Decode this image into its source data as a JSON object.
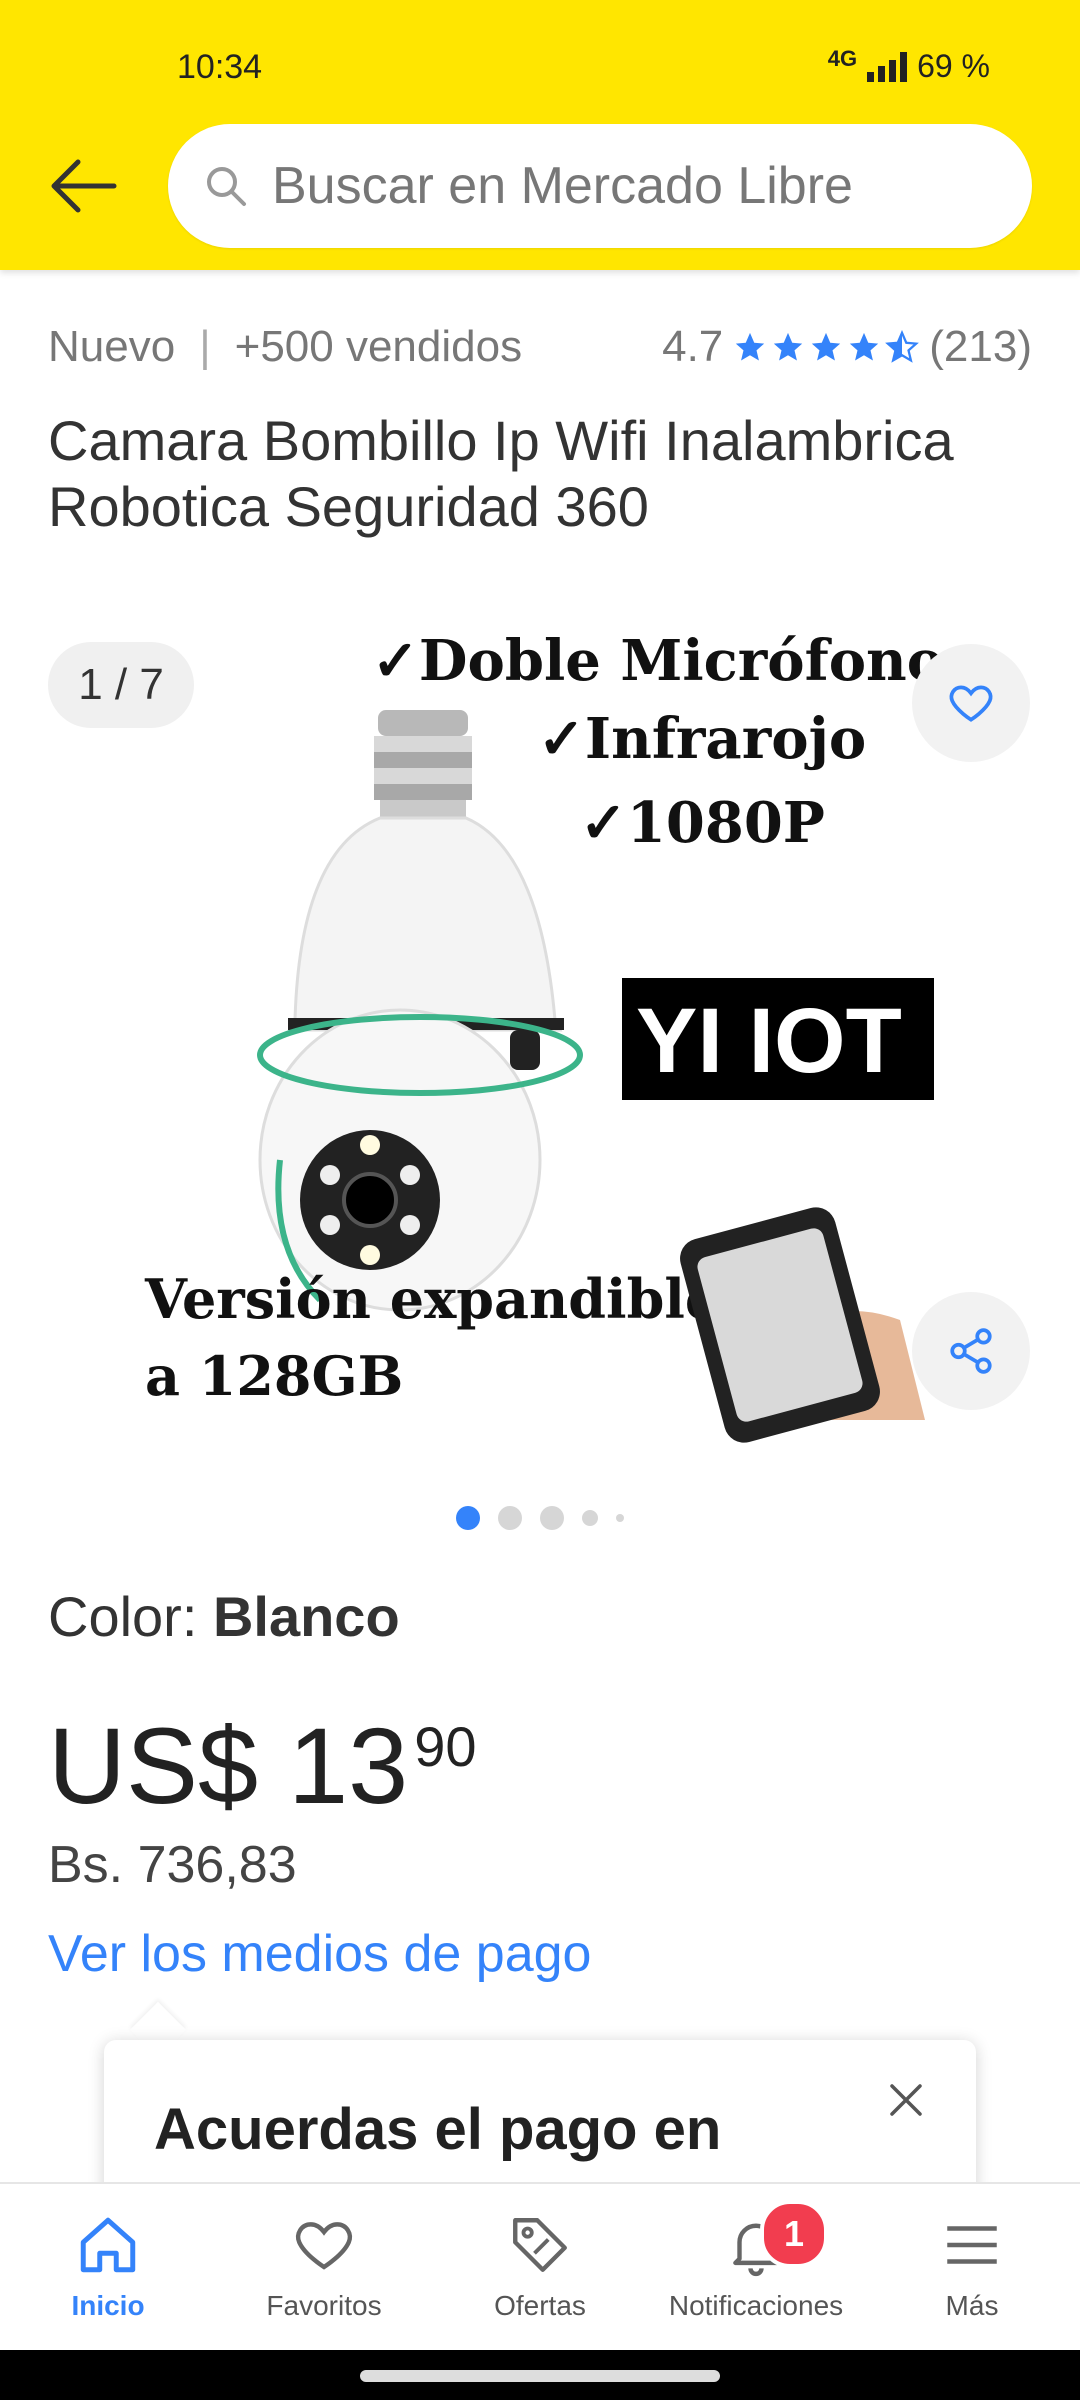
{
  "status_bar": {
    "time": "10:34",
    "network": "4G",
    "battery": "69 %"
  },
  "header": {
    "search_placeholder": "Buscar en Mercado Libre"
  },
  "product": {
    "condition": "Nuevo",
    "separator": "|",
    "sold": "+500 vendidos",
    "rating": "4.7",
    "rating_value": 4.7,
    "reviews": "(213)",
    "title": "Camara Bombillo Ip Wifi Inalambrica Robotica Seguridad 360"
  },
  "gallery": {
    "counter": "1 / 7",
    "image_text": {
      "line1": "✓Doble Micrófono",
      "line2": "✓Infrarojo",
      "line3": "✓1080P",
      "brand": "YI IOT",
      "footer1": "Versión expandible",
      "footer2": "a 128GB"
    },
    "active_dot": 0,
    "dot_count": 5
  },
  "variation": {
    "label": "Color:",
    "value": "Blanco"
  },
  "price": {
    "main": "US$ 13",
    "cents": "90",
    "local": "Bs. 736,83",
    "payment_link": "Ver los medios de pago"
  },
  "tooltip": {
    "title": "Acuerdas el pago en"
  },
  "bottom_nav": {
    "items": [
      {
        "label": "Inicio",
        "icon": "home-icon"
      },
      {
        "label": "Favoritos",
        "icon": "heart-icon"
      },
      {
        "label": "Ofertas",
        "icon": "tag-icon"
      },
      {
        "label": "Notificaciones",
        "icon": "bell-icon",
        "badge": "1"
      },
      {
        "label": "Más",
        "icon": "menu-icon"
      }
    ]
  },
  "colors": {
    "header_yellow": "#FFE600",
    "link_blue": "#3483FA",
    "badge_red": "#F23D4F"
  }
}
